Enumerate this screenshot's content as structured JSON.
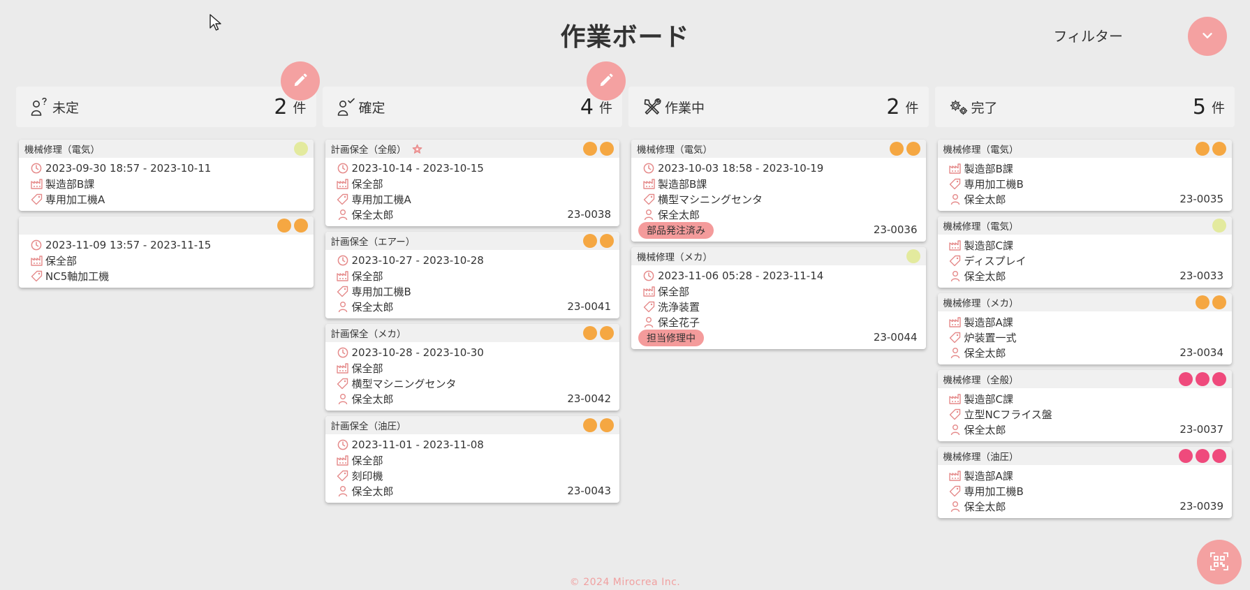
{
  "page": {
    "title": "作業ボード"
  },
  "filter": {
    "label": "フィルター"
  },
  "footer": {
    "copyright": "© 2024  Mirocrea Inc."
  },
  "colors": {
    "accent": "#f4a1a1",
    "dot_orange": "#f5a742",
    "dot_lime": "#e3ea9e",
    "dot_pink": "#ef4a7c",
    "icon": "#e58a8a"
  },
  "columns": [
    {
      "name": "未定",
      "count": "2",
      "unit": "件",
      "icon": "person-question-icon",
      "editable": true,
      "cards": [
        {
          "title": "機械修理（電気）",
          "dots": [
            "lime"
          ],
          "date": "2023-09-30 18:57 - 2023-10-11",
          "dept": "製造部B課",
          "machine": "専用加工機A"
        },
        {
          "title": "",
          "dots": [
            "orange",
            "orange"
          ],
          "date": "2023-11-09 13:57 - 2023-11-15",
          "dept": "保全部",
          "machine": "NC5軸加工機"
        }
      ]
    },
    {
      "name": "確定",
      "count": "4",
      "unit": "件",
      "icon": "person-check-icon",
      "editable": true,
      "cards": [
        {
          "title": "計画保全（全般）",
          "star": true,
          "dots": [
            "orange",
            "orange"
          ],
          "date": "2023-10-14 - 2023-10-15",
          "dept": "保全部",
          "machine": "専用加工機A",
          "person": "保全太郎",
          "id": "23-0038"
        },
        {
          "title": "計画保全（エアー）",
          "dots": [
            "orange",
            "orange"
          ],
          "date": "2023-10-27 - 2023-10-28",
          "dept": "保全部",
          "machine": "専用加工機B",
          "person": "保全太郎",
          "id": "23-0041"
        },
        {
          "title": "計画保全（メカ）",
          "dots": [
            "orange",
            "orange"
          ],
          "date": "2023-10-28 - 2023-10-30",
          "dept": "保全部",
          "machine": "横型マシニングセンタ",
          "person": "保全太郎",
          "id": "23-0042"
        },
        {
          "title": "計画保全（油圧）",
          "dots": [
            "orange",
            "orange"
          ],
          "date": "2023-11-01 - 2023-11-08",
          "dept": "保全部",
          "machine": "刻印機",
          "person": "保全太郎",
          "id": "23-0043"
        }
      ]
    },
    {
      "name": "作業中",
      "count": "2",
      "unit": "件",
      "icon": "tools-icon",
      "editable": false,
      "cards": [
        {
          "title": "機械修理（電気）",
          "dots": [
            "orange",
            "orange"
          ],
          "date": "2023-10-03 18:58 - 2023-10-19",
          "dept": "製造部B課",
          "machine": "横型マシニングセンタ",
          "person": "保全太郎",
          "badge": "部品発注済み",
          "id": "23-0036"
        },
        {
          "title": "機械修理（メカ）",
          "dots": [
            "lime"
          ],
          "date": "2023-11-06 05:28 - 2023-11-14",
          "dept": "保全部",
          "machine": "洗浄装置",
          "person": "保全花子",
          "badge": "担当修理中",
          "id": "23-0044"
        }
      ]
    },
    {
      "name": "完了",
      "count": "5",
      "unit": "件",
      "icon": "gears-icon",
      "editable": false,
      "cards": [
        {
          "title": "機械修理（電気）",
          "dots": [
            "orange",
            "orange"
          ],
          "dept": "製造部B課",
          "machine": "専用加工機B",
          "person": "保全太郎",
          "id": "23-0035"
        },
        {
          "title": "機械修理（電気）",
          "dots": [
            "lime"
          ],
          "dept": "製造部C課",
          "machine": "ディスプレイ",
          "person": "保全太郎",
          "id": "23-0033"
        },
        {
          "title": "機械修理（メカ）",
          "dots": [
            "orange",
            "orange"
          ],
          "dept": "製造部A課",
          "machine": "炉装置一式",
          "person": "保全太郎",
          "id": "23-0034"
        },
        {
          "title": "機械修理（全般）",
          "dots": [
            "pink",
            "pink",
            "pink"
          ],
          "dept": "製造部C課",
          "machine": "立型NCフライス盤",
          "person": "保全太郎",
          "id": "23-0037"
        },
        {
          "title": "機械修理（油圧）",
          "dots": [
            "pink",
            "pink",
            "pink"
          ],
          "dept": "製造部A課",
          "machine": "専用加工機B",
          "person": "保全太郎",
          "id": "23-0039"
        }
      ]
    }
  ]
}
